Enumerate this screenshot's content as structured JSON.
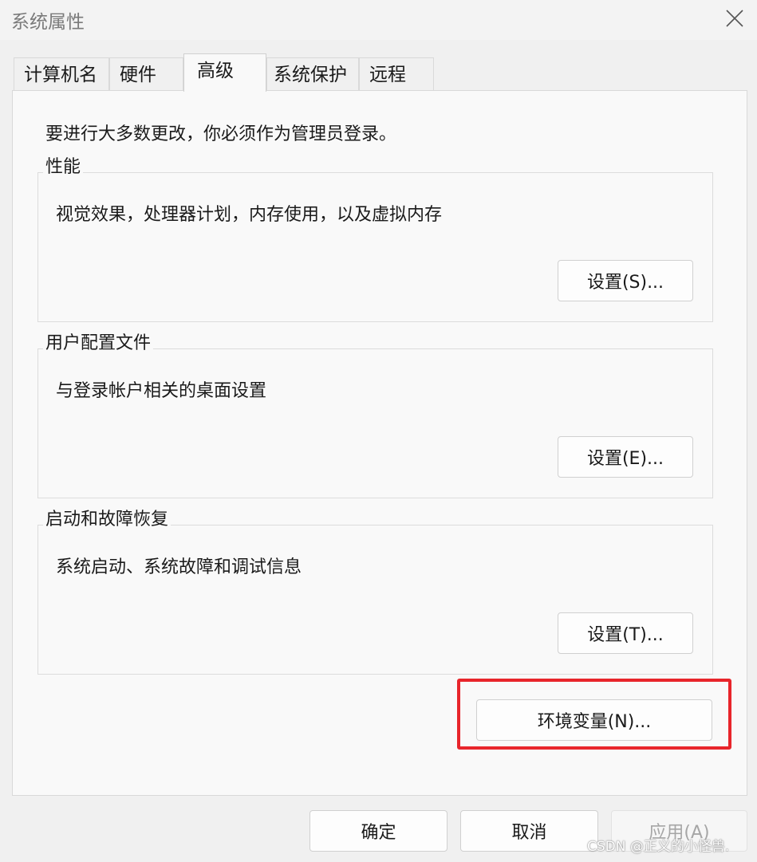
{
  "window": {
    "title": "系统属性"
  },
  "tabs": [
    {
      "label": "计算机名"
    },
    {
      "label": "硬件"
    },
    {
      "label": "高级",
      "active": true
    },
    {
      "label": "系统保护"
    },
    {
      "label": "远程"
    }
  ],
  "notice": "要进行大多数更改，你必须作为管理员登录。",
  "groups": {
    "performance": {
      "title": "性能",
      "description": "视觉效果，处理器计划，内存使用，以及虚拟内存",
      "button": "设置(S)..."
    },
    "user_profiles": {
      "title": "用户配置文件",
      "description": "与登录帐户相关的桌面设置",
      "button": "设置(E)..."
    },
    "startup_recovery": {
      "title": "启动和故障恢复",
      "description": "系统启动、系统故障和调试信息",
      "button": "设置(T)..."
    }
  },
  "env_button": "环境变量(N)...",
  "footer": {
    "ok": "确定",
    "cancel": "取消",
    "apply": "应用(A)"
  },
  "watermark": "CSDN @正义的小怪兽.",
  "colors": {
    "highlight": "#e8252b"
  },
  "icons": {
    "close": "close-icon"
  }
}
